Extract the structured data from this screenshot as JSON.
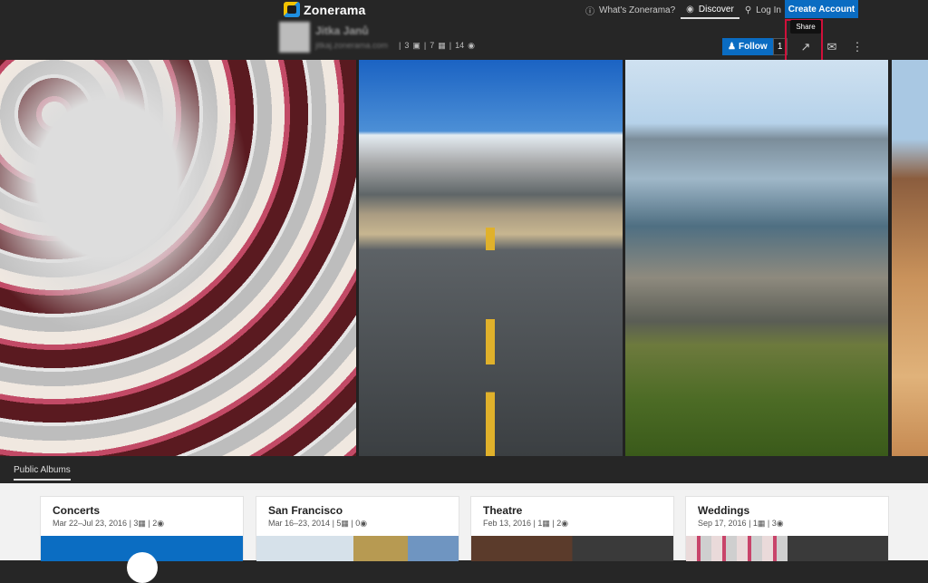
{
  "header": {
    "logo_text": "Zonerama",
    "nav": [
      {
        "label": "What's Zonerama?",
        "icon": "question-circle-icon"
      },
      {
        "label": "Discover",
        "icon": "globe-icon"
      },
      {
        "label": "Log In",
        "icon": "key-icon"
      }
    ],
    "create_account": "Create Account"
  },
  "profile": {
    "name": "Jitka Janů",
    "url": "jitkaj.zonerama.com",
    "albums_count": "3",
    "photos_count": "7",
    "views_count": "14",
    "follow_label": "Follow",
    "follow_count": "1",
    "share_tooltip": "Share"
  },
  "hero": {
    "photos": [
      "cupcakes",
      "desert-road",
      "coastal-cliffs",
      "sandstone-rocks"
    ]
  },
  "albums_tab": "Public Albums",
  "albums": [
    {
      "title": "Concerts",
      "date": "Mar 22–Jul 23, 2016",
      "photos": "3",
      "views": "2"
    },
    {
      "title": "San Francisco",
      "date": "Mar 16–23, 2014",
      "photos": "5",
      "views": "0"
    },
    {
      "title": "Theatre",
      "date": "Feb 13, 2016",
      "photos": "1",
      "views": "2"
    },
    {
      "title": "Weddings",
      "date": "Sep 17, 2016",
      "photos": "1",
      "views": "3"
    }
  ],
  "colors": {
    "accent": "#0a6cc2",
    "highlight": "#d0103a",
    "dark_bg": "#262626"
  }
}
